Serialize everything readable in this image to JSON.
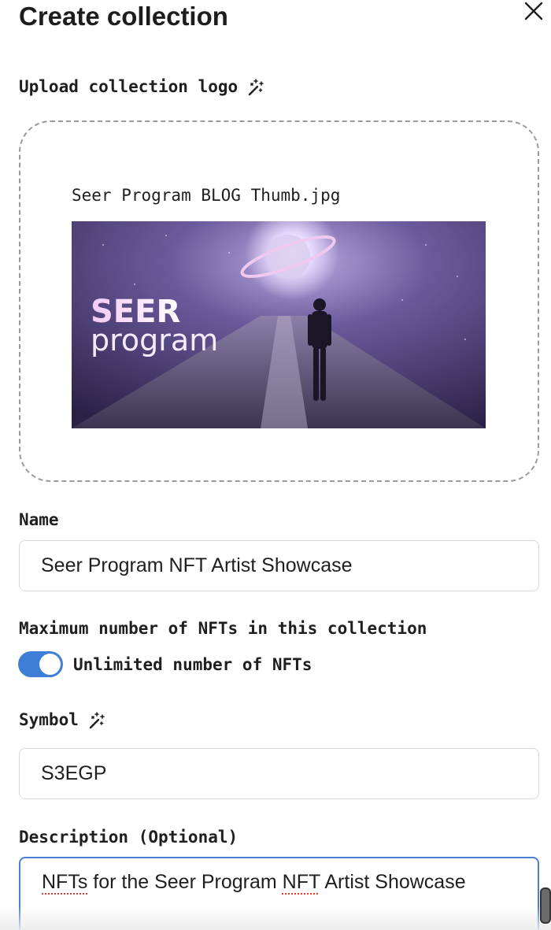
{
  "dialog": {
    "title": "Create collection",
    "close_icon": "close-icon"
  },
  "logo": {
    "label": "Upload collection logo",
    "magic_icon": "magic-wand-icon",
    "file_name": "Seer Program BLOG Thumb.jpg",
    "preview_text_line1": "SEER",
    "preview_text_line2": "program"
  },
  "name": {
    "label": "Name",
    "value": "Seer Program NFT Artist Showcase"
  },
  "max_nfts": {
    "label": "Maximum number of NFTs in this collection",
    "toggle_label": "Unlimited number of NFTs",
    "toggle_on": true,
    "toggle_color": "#3e7ed6"
  },
  "symbol": {
    "label": "Symbol",
    "magic_icon": "magic-wand-icon",
    "value": "S3EGP"
  },
  "description": {
    "label": "Description (Optional)",
    "value_part1": "NFTs",
    "value_part2": " for the Seer Program ",
    "value_part3": "NFT",
    "value_part4": " Artist Showcase",
    "focus_color": "#4a7fd1"
  }
}
